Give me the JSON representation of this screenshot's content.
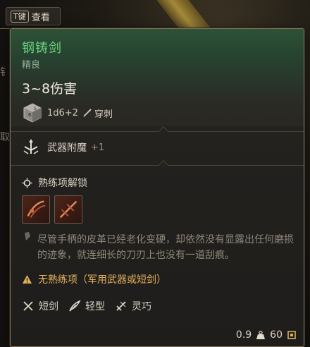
{
  "peek": {
    "key": "T键",
    "label": "查看"
  },
  "side": {
    "stub_1": "钅",
    "stub_2": "取"
  },
  "item": {
    "name": "钢铸剑",
    "rarity": "精良",
    "damage": "3~8伤害",
    "dice": "1d6+2",
    "damage_type": "穿刺",
    "enchant_label": "武器附魔",
    "enchant_value": "+1",
    "proficiency_label": "熟练项解锁",
    "flavor": "尽管手柄的皮革已经老化变硬，却依然没有显露出任何磨损的迹象，就连细长的刀刃上也没有一道刮痕。",
    "warning": "无熟练项（军用武器或短剑）",
    "properties": [
      {
        "label": "短剑",
        "icon": "crossed-swords-icon"
      },
      {
        "label": "轻型",
        "icon": "feather-icon"
      },
      {
        "label": "灵巧",
        "icon": "dagger-icon"
      }
    ],
    "weight": "0.9",
    "price": "60"
  },
  "colors": {
    "name": "#6ad37c",
    "warning": "#e3b15a",
    "border": "#857357"
  }
}
